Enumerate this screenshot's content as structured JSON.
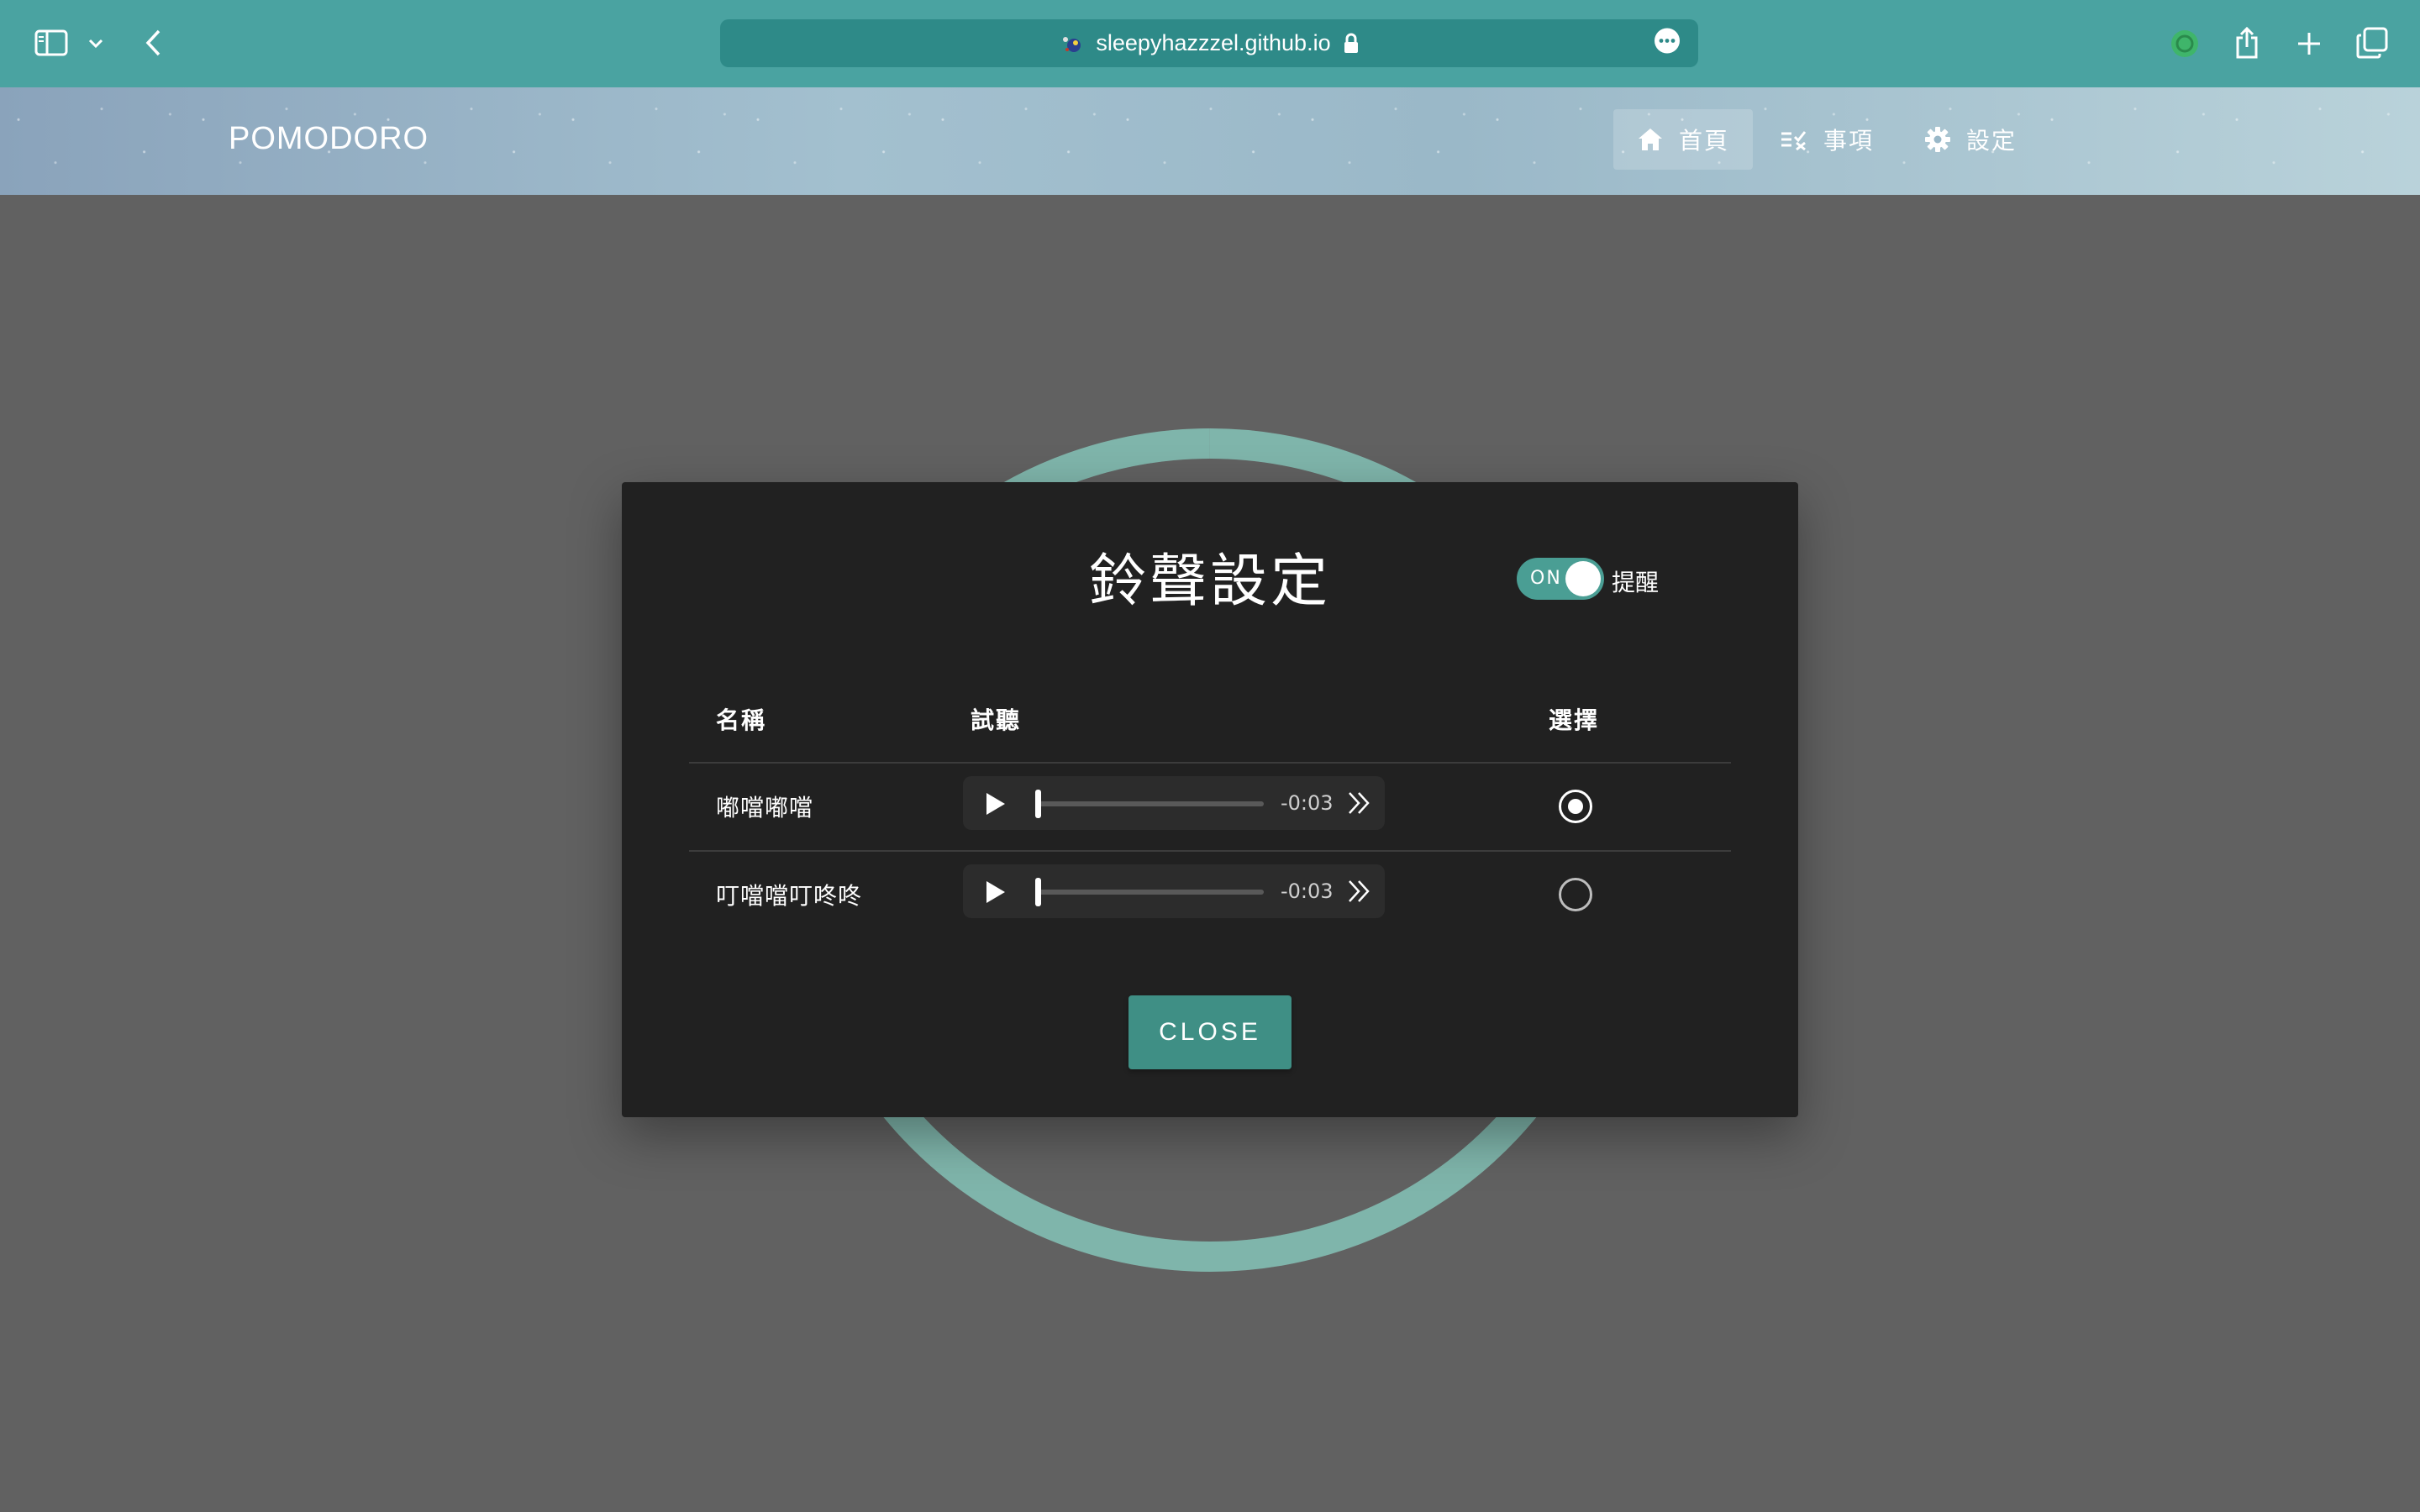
{
  "browser": {
    "url": "sleepyhazzzel.github.io",
    "icons": [
      "sidebar-icon",
      "chevron-down-icon",
      "back-arrow-icon",
      "lock-icon",
      "more-icon",
      "extension-icon",
      "share-icon",
      "plus-icon",
      "tabs-icon"
    ]
  },
  "header": {
    "title": "POMODORO",
    "nav": [
      {
        "label": "首頁",
        "icon": "home-icon",
        "active": true
      },
      {
        "label": "事項",
        "icon": "checklist-icon",
        "active": false
      },
      {
        "label": "設定",
        "icon": "gear-icon",
        "active": false
      }
    ]
  },
  "colors": {
    "accent": "#4aa3a1",
    "toggle": "#4a9e94",
    "button": "#3f8f85",
    "ring": "#7fb5ab"
  },
  "dialog": {
    "title": "鈴聲設定",
    "toggle": {
      "state": "ON",
      "label": "提醒"
    },
    "columns": {
      "name": "名稱",
      "preview": "試聽",
      "select": "選擇"
    },
    "rows": [
      {
        "name": "嘟噹嘟噹",
        "time": "-0:03",
        "progress": 0,
        "selected": true
      },
      {
        "name": "叮噹噹叮咚咚",
        "time": "-0:03",
        "progress": 0,
        "selected": false
      }
    ],
    "close_label": "CLOSE"
  }
}
